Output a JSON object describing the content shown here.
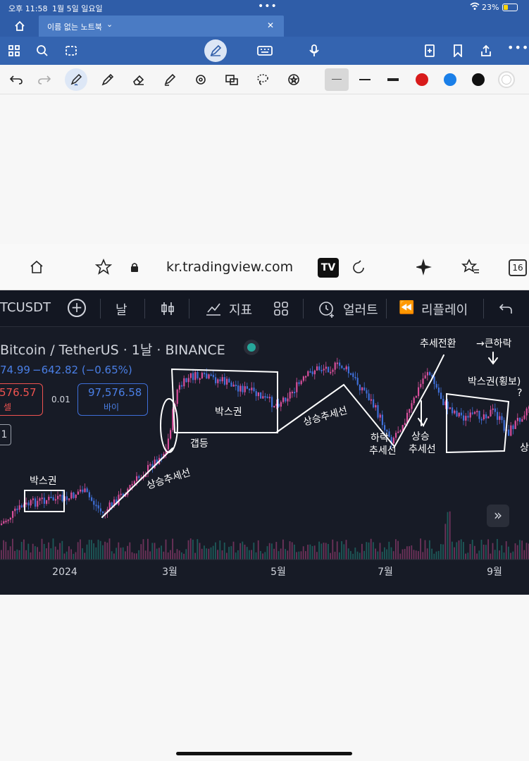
{
  "status": {
    "time": "오후 11:58",
    "date": "1월 5일 일요일",
    "battery": "23%"
  },
  "tab": {
    "title": "이름 없는 노트북"
  },
  "browser": {
    "url": "kr.tradingview.com",
    "tabs_count": "16"
  },
  "tv_toolbar": {
    "symbol": "TCUSDT",
    "interval": "날",
    "indicators": "지표",
    "alerts": "얼러트",
    "replay": "리플레이"
  },
  "legend": {
    "title": "Bitcoin / TetherUS · 1날 · BINANCE",
    "price_line": "74.99",
    "change": "−642.82 (−0.65%)",
    "sell_price": "576.57",
    "sell_label": "셀",
    "spread": "0.01",
    "buy_price": "97,576.58",
    "buy_label": "바이",
    "side_value": "1"
  },
  "x_axis": {
    "labels": [
      "2024",
      "3월",
      "5월",
      "7월",
      "9월"
    ]
  },
  "annotations": {
    "box1": "박스권",
    "gap": "갭등",
    "uptrend1": "상승추세선",
    "box2": "박스권",
    "uptrend2": "상승추세선",
    "down": "하락",
    "down2": "추세선",
    "up": "상승",
    "up2": "추세선",
    "reversal": "추세전환",
    "arrow_text": "→큰하락",
    "box3": "박스권(횡보)",
    "question": "?",
    "right_edge": "상"
  },
  "colors": {
    "up": "#26a69a",
    "down": "#ef5350",
    "candle_pink": "#d94f9c",
    "candle_blue": "#3f6fd8",
    "accent": "#2f5da8"
  }
}
